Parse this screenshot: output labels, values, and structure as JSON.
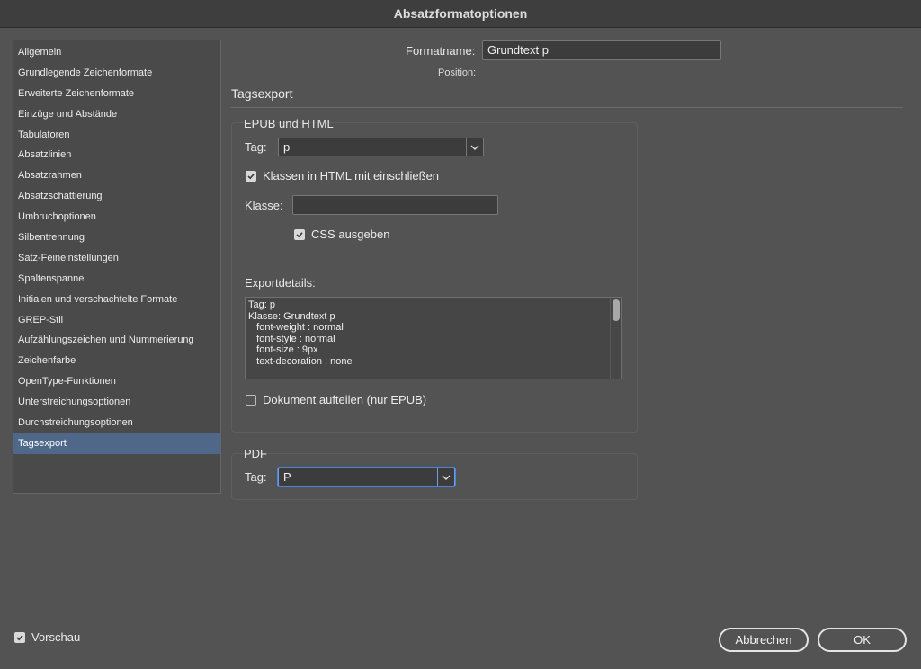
{
  "window": {
    "title": "Absatzformatoptionen"
  },
  "sidebar": {
    "items": [
      "Allgemein",
      "Grundlegende Zeichenformate",
      "Erweiterte Zeichenformate",
      "Einzüge und Abstände",
      "Tabulatoren",
      "Absatzlinien",
      "Absatzrahmen",
      "Absatzschattierung",
      "Umbruchoptionen",
      "Silbentrennung",
      "Satz-Feineinstellungen",
      "Spaltenspanne",
      "Initialen und verschachtelte Formate",
      "GREP-Stil",
      "Aufzählungszeichen und Nummerierung",
      "Zeichenfarbe",
      "OpenType-Funktionen",
      "Unterstreichungsoptionen",
      "Durchstreichungsoptionen",
      "Tagsexport"
    ],
    "selected": "Tagsexport"
  },
  "header": {
    "format_name_label": "Formatname:",
    "format_name_value": "Grundtext p",
    "position_label": "Position:",
    "section_title": "Tagsexport"
  },
  "epub": {
    "title": "EPUB und HTML",
    "tag_label": "Tag:",
    "tag_value": "p",
    "include_classes_label": "Klassen in HTML mit einschließen",
    "include_classes_checked": true,
    "class_label": "Klasse:",
    "class_value": "",
    "css_label": "CSS ausgeben",
    "css_checked": true,
    "details_label": "Exportdetails:",
    "details_lines": [
      "Tag: p",
      "Klasse: Grundtext p",
      "   font-weight : normal",
      "   font-style : normal",
      "   font-size : 9px",
      "   text-decoration : none"
    ],
    "split_label": "Dokument aufteilen (nur EPUB)",
    "split_checked": false
  },
  "pdf": {
    "title": "PDF",
    "tag_label": "Tag:",
    "tag_value": "P"
  },
  "footer": {
    "preview_label": "Vorschau",
    "preview_checked": true,
    "cancel_label": "Abbrechen",
    "ok_label": "OK"
  }
}
